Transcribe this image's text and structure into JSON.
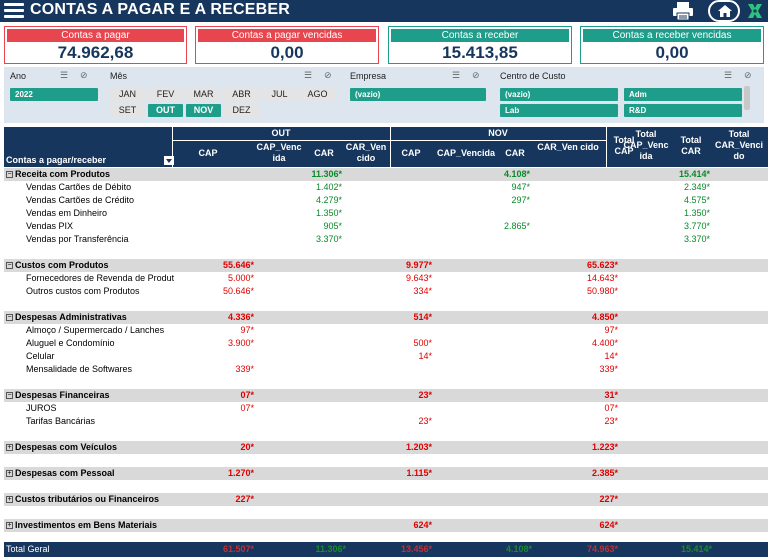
{
  "header": {
    "title": "CONTAS A PAGAR E A RECEBER"
  },
  "kpis": [
    {
      "label": "Contas a pagar",
      "value": "74.962,68",
      "color": "#e8464e"
    },
    {
      "label": "Contas a pagar vencidas",
      "value": "0,00",
      "color": "#e8464e"
    },
    {
      "label": "Contas a receber",
      "value": "15.413,85",
      "color": "#1e9e8a"
    },
    {
      "label": "Contas a receber vencidas",
      "value": "0,00",
      "color": "#1e9e8a"
    }
  ],
  "filters": {
    "ano": {
      "label": "Ano",
      "value": "2022"
    },
    "mes": {
      "label": "Mês",
      "months": [
        "JAN",
        "FEV",
        "MAR",
        "ABR",
        "JUL",
        "AGO",
        "SET",
        "OUT",
        "NOV",
        "DEZ"
      ],
      "selected": [
        "OUT",
        "NOV"
      ]
    },
    "empresa": {
      "label": "Empresa",
      "value": "(vazio)"
    },
    "centro": {
      "label": "Centro de Custo",
      "items": [
        "(vazio)",
        "Adm",
        "Lab",
        "R&D"
      ]
    }
  },
  "table": {
    "group_out": "OUT",
    "group_nov": "NOV",
    "row_header": "Contas a pagar/receber",
    "col_cap": "CAP",
    "col_cap_venc": "CAP_Venc ida",
    "col_car": "CAR",
    "col_car_venc": "CAR_Ven cido",
    "col_cap_venc_nov": "CAP_Vencida",
    "col_total_cap": "Total CAP",
    "col_total_cap_venc": "Total CAP_Venc ida",
    "col_total_car": "Total CAR",
    "col_total_car_venc": "Total CAR_Venci do",
    "rows": [
      {
        "type": "cat",
        "label": "Receita com Produtos",
        "out_car": "11.306*",
        "nov_car": "4.108*",
        "tot_car": "15.414*"
      },
      {
        "type": "item",
        "label": "Vendas Cartões de  Débito",
        "out_car": "1.402*",
        "nov_car": "947*",
        "tot_car": "2.349*"
      },
      {
        "type": "item",
        "label": "Vendas Cartões de Crédito",
        "out_car": "4.279*",
        "nov_car": "297*",
        "tot_car": "4.575*"
      },
      {
        "type": "item",
        "label": "Vendas em Dinheiro",
        "out_car": "1.350*",
        "tot_car": "1.350*"
      },
      {
        "type": "item",
        "label": "Vendas PIX",
        "out_car": "905*",
        "nov_car": "2.865*",
        "tot_car": "3.770*"
      },
      {
        "type": "item",
        "label": "Vendas por Transferência",
        "out_car": "3.370*",
        "tot_car": "3.370*"
      },
      {
        "type": "blank"
      },
      {
        "type": "cat",
        "label": "Custos com Produtos",
        "out_cap": "55.646*",
        "nov_cap": "9.977*",
        "tot_cap": "65.623*"
      },
      {
        "type": "item",
        "label": "Fornecedores de Revenda de Produt",
        "out_cap": "5.000*",
        "nov_cap": "9.643*",
        "tot_cap": "14.643*"
      },
      {
        "type": "item",
        "label": "Outros custos com Produtos",
        "out_cap": "50.646*",
        "nov_cap": "334*",
        "tot_cap": "50.980*"
      },
      {
        "type": "blank"
      },
      {
        "type": "cat",
        "label": "Despesas Administrativas",
        "out_cap": "4.336*",
        "nov_cap": "514*",
        "tot_cap": "4.850*"
      },
      {
        "type": "item",
        "label": "Almoço / Supermercado / Lanches",
        "out_cap": "97*",
        "tot_cap": "97*"
      },
      {
        "type": "item",
        "label": "Aluguel e Condomínio",
        "out_cap": "3.900*",
        "nov_cap": "500*",
        "tot_cap": "4.400*"
      },
      {
        "type": "item",
        "label": "Celular",
        "nov_cap": "14*",
        "tot_cap": "14*"
      },
      {
        "type": "item",
        "label": "Mensalidade de Softwares",
        "out_cap": "339*",
        "tot_cap": "339*"
      },
      {
        "type": "blank"
      },
      {
        "type": "cat",
        "label": "Despesas Financeiras",
        "out_cap": "07*",
        "nov_cap": "23*",
        "tot_cap": "31*"
      },
      {
        "type": "item",
        "label": "JUROS",
        "out_cap": "07*",
        "tot_cap": "07*"
      },
      {
        "type": "item",
        "label": "Tarifas Bancárias",
        "nov_cap": "23*",
        "tot_cap": "23*"
      },
      {
        "type": "blank"
      },
      {
        "type": "cat",
        "label": "Despesas com Veículos",
        "out_cap": "20*",
        "nov_cap": "1.203*",
        "tot_cap": "1.223*"
      },
      {
        "type": "blank"
      },
      {
        "type": "cat",
        "label": "Despesas com Pessoal",
        "out_cap": "1.270*",
        "nov_cap": "1.115*",
        "tot_cap": "2.385*"
      },
      {
        "type": "blank"
      },
      {
        "type": "cat",
        "label": "Custos tributários ou Financeiros",
        "out_cap": "227*",
        "tot_cap": "227*"
      },
      {
        "type": "blank"
      },
      {
        "type": "cat",
        "label": "Investimentos em Bens Materiais",
        "nov_cap": "624*",
        "tot_cap": "624*"
      },
      {
        "type": "blank"
      }
    ],
    "total": {
      "label": "Total Geral",
      "out_cap": "61.507*",
      "out_car": "11.306*",
      "nov_cap": "13.456*",
      "nov_car": "4.108*",
      "tot_cap": "74.963*",
      "tot_car": "15.414*"
    }
  },
  "colors": {
    "navy": "#17365d",
    "red": "#e8464e",
    "teal": "#1e9e8a"
  }
}
